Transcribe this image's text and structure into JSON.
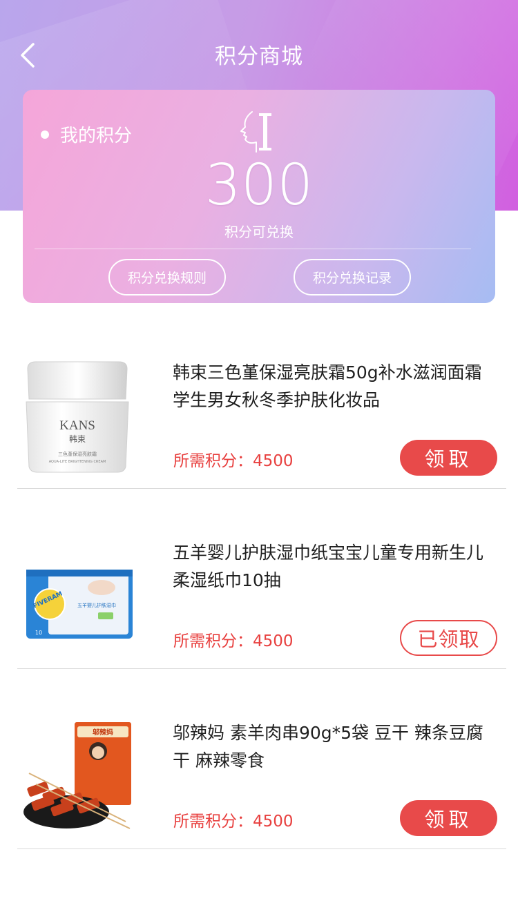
{
  "header": {
    "title": "积分商城",
    "back_icon": "chevron-left-icon"
  },
  "points_card": {
    "label": "我的积分",
    "value": "300",
    "subtitle": "积分可兑换",
    "rules_button": "积分兑换规则",
    "records_button": "积分兑换记录"
  },
  "products": [
    {
      "name": "韩束三色堇保湿亮肤霜50g补水滋润面霜学生男女秋冬季护肤化妆品",
      "price": "所需积分：4500",
      "button": "领取",
      "status": "active",
      "image": "cream-jar-image",
      "image_text": {
        "brand": "KANS",
        "brand_cn": "韩束",
        "line1": "三色堇保湿亮肤霜",
        "line2": "AQUA-LITE BRIGHTENING CREAM"
      }
    },
    {
      "name": "五羊婴儿护肤湿巾纸宝宝儿童专用新生儿柔湿纸巾10抽",
      "price": "所需积分：4500",
      "button": "已领取",
      "status": "claimed",
      "image": "wet-wipes-pack-image",
      "image_text": {
        "brand": "FIVERAM",
        "line1": "五羊婴儿护肤湿巾",
        "count": "10"
      }
    },
    {
      "name": "邬辣妈 素羊肉串90g*5袋 豆干 辣条豆腐干 麻辣零食",
      "price": "所需积分：4500",
      "button": "领取",
      "status": "active",
      "image": "spicy-skewers-snack-image",
      "image_text": {
        "brand": "邬辣妈"
      }
    }
  ],
  "colors": {
    "accent": "#e84a4a",
    "header_start": "#b9a6ec",
    "header_end": "#d15fe0",
    "card_start": "#f5a6d9",
    "card_end": "#a6bcf3"
  }
}
